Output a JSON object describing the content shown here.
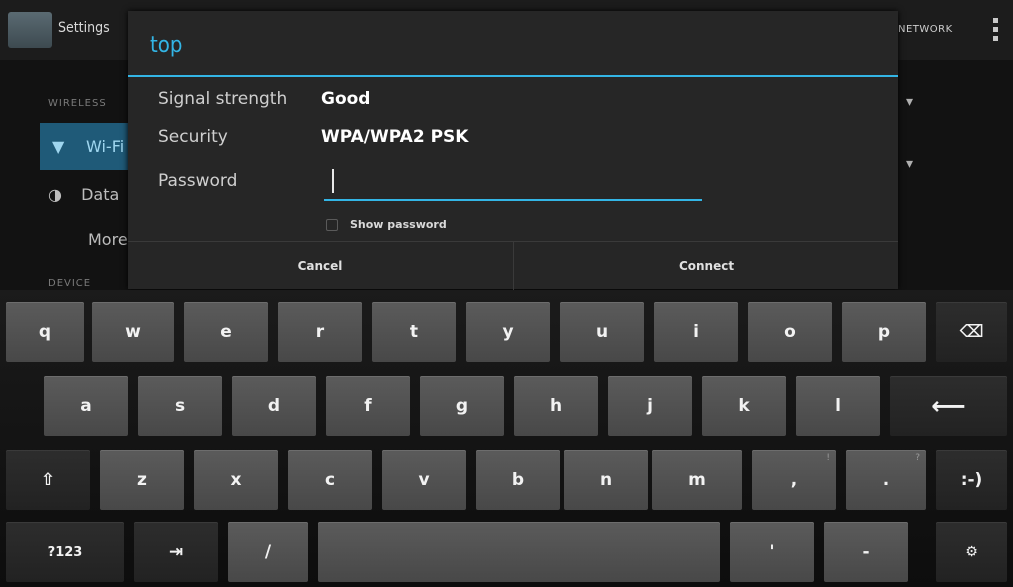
{
  "background": {
    "app_title": "Settings",
    "action": "NETWORK",
    "section_wireless": "WIRELESS",
    "wifi_item": "Wi-Fi",
    "data_item": "Data",
    "more_item": "More",
    "section_device": "DEVICE"
  },
  "dialog": {
    "title": "top",
    "signal_label": "Signal strength",
    "signal_value": "Good",
    "security_label": "Security",
    "security_value": "WPA/WPA2 PSK",
    "password_label": "Password",
    "password_value": "",
    "show_password_label": "Show password",
    "cancel_label": "Cancel",
    "connect_label": "Connect"
  },
  "keyboard": {
    "row1": [
      "q",
      "w",
      "e",
      "r",
      "t",
      "y",
      "u",
      "i",
      "o",
      "p"
    ],
    "row2": [
      "a",
      "s",
      "d",
      "f",
      "g",
      "h",
      "j",
      "k",
      "l"
    ],
    "row3": [
      "z",
      "x",
      "c",
      "v",
      "b",
      "n",
      "m",
      ",",
      "."
    ],
    "row3_hints": [
      "!",
      "?"
    ],
    "row4": [
      "?123",
      "/",
      "'",
      "-"
    ],
    "emoticon_label": ":-)",
    "tab_icon": "tab-arrow-icon",
    "backspace_icon": "backspace-icon",
    "enter_icon": "enter-arrow-icon",
    "shift_icon": "shift-arrow-icon",
    "settings_icon": "keyboard-settings-icon"
  },
  "colors": {
    "accent": "#33b5e5",
    "dialog_bg": "#262626",
    "key_bg": "#555555"
  }
}
